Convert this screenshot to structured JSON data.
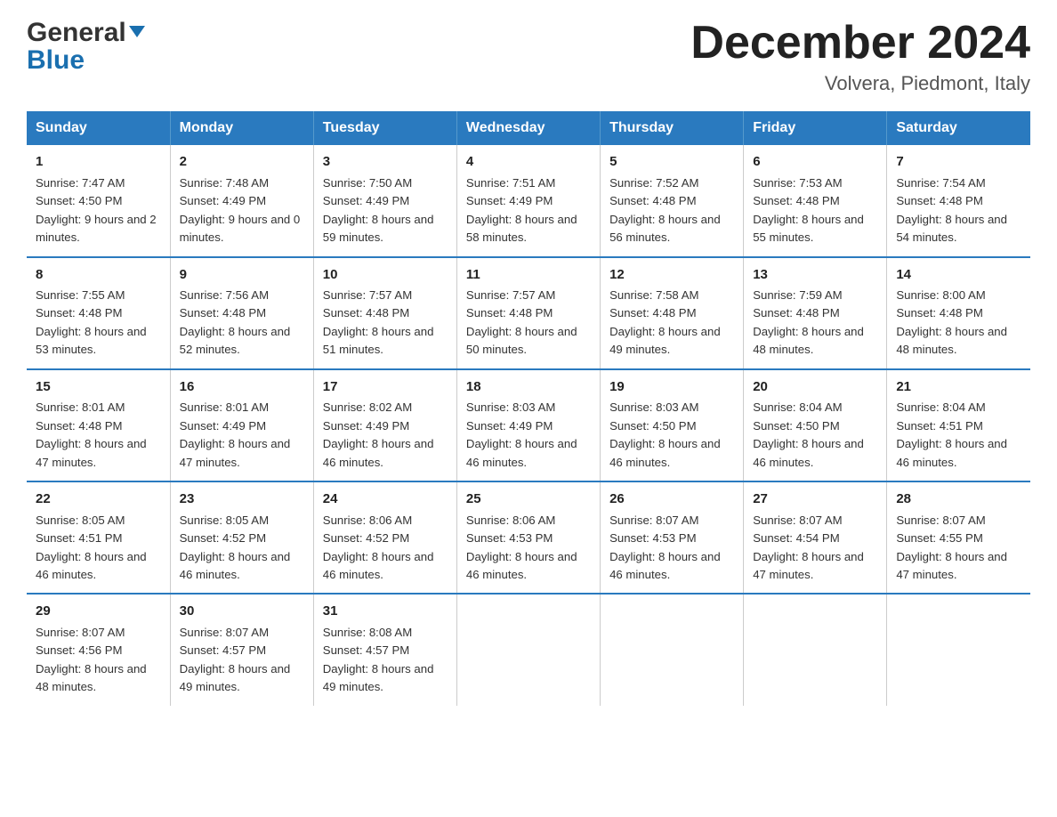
{
  "logo": {
    "line1_black": "General",
    "line1_blue_arrow": "▶",
    "line2": "Blue"
  },
  "title": "December 2024",
  "subtitle": "Volvera, Piedmont, Italy",
  "days_of_week": [
    "Sunday",
    "Monday",
    "Tuesday",
    "Wednesday",
    "Thursday",
    "Friday",
    "Saturday"
  ],
  "weeks": [
    [
      {
        "day": "1",
        "sunrise": "7:47 AM",
        "sunset": "4:50 PM",
        "daylight": "9 hours and 2 minutes."
      },
      {
        "day": "2",
        "sunrise": "7:48 AM",
        "sunset": "4:49 PM",
        "daylight": "9 hours and 0 minutes."
      },
      {
        "day": "3",
        "sunrise": "7:50 AM",
        "sunset": "4:49 PM",
        "daylight": "8 hours and 59 minutes."
      },
      {
        "day": "4",
        "sunrise": "7:51 AM",
        "sunset": "4:49 PM",
        "daylight": "8 hours and 58 minutes."
      },
      {
        "day": "5",
        "sunrise": "7:52 AM",
        "sunset": "4:48 PM",
        "daylight": "8 hours and 56 minutes."
      },
      {
        "day": "6",
        "sunrise": "7:53 AM",
        "sunset": "4:48 PM",
        "daylight": "8 hours and 55 minutes."
      },
      {
        "day": "7",
        "sunrise": "7:54 AM",
        "sunset": "4:48 PM",
        "daylight": "8 hours and 54 minutes."
      }
    ],
    [
      {
        "day": "8",
        "sunrise": "7:55 AM",
        "sunset": "4:48 PM",
        "daylight": "8 hours and 53 minutes."
      },
      {
        "day": "9",
        "sunrise": "7:56 AM",
        "sunset": "4:48 PM",
        "daylight": "8 hours and 52 minutes."
      },
      {
        "day": "10",
        "sunrise": "7:57 AM",
        "sunset": "4:48 PM",
        "daylight": "8 hours and 51 minutes."
      },
      {
        "day": "11",
        "sunrise": "7:57 AM",
        "sunset": "4:48 PM",
        "daylight": "8 hours and 50 minutes."
      },
      {
        "day": "12",
        "sunrise": "7:58 AM",
        "sunset": "4:48 PM",
        "daylight": "8 hours and 49 minutes."
      },
      {
        "day": "13",
        "sunrise": "7:59 AM",
        "sunset": "4:48 PM",
        "daylight": "8 hours and 48 minutes."
      },
      {
        "day": "14",
        "sunrise": "8:00 AM",
        "sunset": "4:48 PM",
        "daylight": "8 hours and 48 minutes."
      }
    ],
    [
      {
        "day": "15",
        "sunrise": "8:01 AM",
        "sunset": "4:48 PM",
        "daylight": "8 hours and 47 minutes."
      },
      {
        "day": "16",
        "sunrise": "8:01 AM",
        "sunset": "4:49 PM",
        "daylight": "8 hours and 47 minutes."
      },
      {
        "day": "17",
        "sunrise": "8:02 AM",
        "sunset": "4:49 PM",
        "daylight": "8 hours and 46 minutes."
      },
      {
        "day": "18",
        "sunrise": "8:03 AM",
        "sunset": "4:49 PM",
        "daylight": "8 hours and 46 minutes."
      },
      {
        "day": "19",
        "sunrise": "8:03 AM",
        "sunset": "4:50 PM",
        "daylight": "8 hours and 46 minutes."
      },
      {
        "day": "20",
        "sunrise": "8:04 AM",
        "sunset": "4:50 PM",
        "daylight": "8 hours and 46 minutes."
      },
      {
        "day": "21",
        "sunrise": "8:04 AM",
        "sunset": "4:51 PM",
        "daylight": "8 hours and 46 minutes."
      }
    ],
    [
      {
        "day": "22",
        "sunrise": "8:05 AM",
        "sunset": "4:51 PM",
        "daylight": "8 hours and 46 minutes."
      },
      {
        "day": "23",
        "sunrise": "8:05 AM",
        "sunset": "4:52 PM",
        "daylight": "8 hours and 46 minutes."
      },
      {
        "day": "24",
        "sunrise": "8:06 AM",
        "sunset": "4:52 PM",
        "daylight": "8 hours and 46 minutes."
      },
      {
        "day": "25",
        "sunrise": "8:06 AM",
        "sunset": "4:53 PM",
        "daylight": "8 hours and 46 minutes."
      },
      {
        "day": "26",
        "sunrise": "8:07 AM",
        "sunset": "4:53 PM",
        "daylight": "8 hours and 46 minutes."
      },
      {
        "day": "27",
        "sunrise": "8:07 AM",
        "sunset": "4:54 PM",
        "daylight": "8 hours and 47 minutes."
      },
      {
        "day": "28",
        "sunrise": "8:07 AM",
        "sunset": "4:55 PM",
        "daylight": "8 hours and 47 minutes."
      }
    ],
    [
      {
        "day": "29",
        "sunrise": "8:07 AM",
        "sunset": "4:56 PM",
        "daylight": "8 hours and 48 minutes."
      },
      {
        "day": "30",
        "sunrise": "8:07 AM",
        "sunset": "4:57 PM",
        "daylight": "8 hours and 49 minutes."
      },
      {
        "day": "31",
        "sunrise": "8:08 AM",
        "sunset": "4:57 PM",
        "daylight": "8 hours and 49 minutes."
      },
      null,
      null,
      null,
      null
    ]
  ]
}
